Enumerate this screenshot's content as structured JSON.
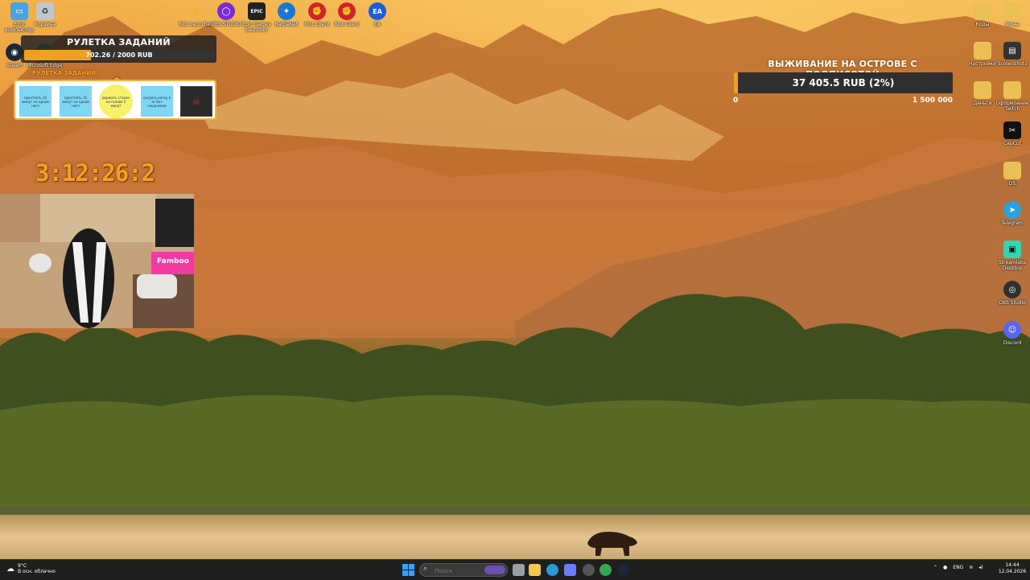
{
  "desktop_left": [
    {
      "label": "Этот компьютер",
      "icon": "monitor-icon",
      "color": "#4aa3df"
    },
    {
      "label": "Корзина",
      "icon": "recycle-bin-icon",
      "color": "#bfc8d0"
    },
    {
      "label": "Steam",
      "icon": "steam-icon",
      "color": "#1b2838"
    },
    {
      "label": "Microsoft Edge",
      "icon": "edge-icon",
      "color": "#2a8a6a"
    }
  ],
  "desktop_top": [
    {
      "label": "Riot Launcher",
      "icon": "riot-launcher-icon",
      "color": "#f2b20f"
    },
    {
      "label": "OBS STUDIO",
      "icon": "obs-circle-icon",
      "color": "#7a2bd6"
    },
    {
      "label": "Epic Games Launcher",
      "icon": "epic-games-icon",
      "color": "#222222",
      "glyph": "EPIC"
    },
    {
      "label": "BattleNet",
      "icon": "battlenet-icon",
      "color": "#1a77d4"
    },
    {
      "label": "Riot Client",
      "icon": "riot-client-icon",
      "color": "#d2232a"
    },
    {
      "label": "Riot Client",
      "icon": "riot-client-2-icon",
      "color": "#d2232a"
    },
    {
      "label": "EA",
      "icon": "ea-icon",
      "color": "#1c5de0",
      "glyph": "EA"
    }
  ],
  "desktop_right": [
    {
      "label": "Коды",
      "icon": "folder-icon",
      "color": "#eac054"
    },
    {
      "label": "Фоны",
      "icon": "folder-icon",
      "color": "#eac054"
    },
    {
      "label": "Настройки",
      "icon": "folder-icon",
      "color": "#eac054"
    },
    {
      "label": "Screenshots",
      "icon": "screenshots-icon",
      "color": "#333333"
    },
    {
      "label": "Деньги",
      "icon": "folder-icon",
      "color": "#eac054"
    },
    {
      "label": "Оформление Twitch",
      "icon": "folder-icon",
      "color": "#eac054"
    },
    {
      "label": "CapCut",
      "icon": "capcut-icon",
      "color": "#111111"
    },
    {
      "label": "DS",
      "icon": "folder-icon",
      "color": "#eac054"
    },
    {
      "label": "Telegram",
      "icon": "telegram-icon",
      "color": "#2aa3dc"
    },
    {
      "label": "Streamlabs Desktop",
      "icon": "streamlabs-icon",
      "color": "#2fd6b0"
    },
    {
      "label": "OBS Studio",
      "icon": "obs-icon",
      "color": "#303030"
    },
    {
      "label": "Discord",
      "icon": "discord-icon",
      "color": "#5865f2"
    }
  ],
  "roulette": {
    "title": "РУЛЕТКА ЗАДАНИЙ",
    "value_text": "702.26 / 2000 RUB",
    "progress": 0.351,
    "subtitle": "РУЛЕТКА ЗАДАНИЙ",
    "cards": [
      "простоять 10 минут на одной ноге",
      "простоять 10 минут на одной ноге",
      "держать стакан на голове 5 минут",
      "сыграть катку в кс без наушников",
      "☠"
    ]
  },
  "timer": "3:12:26:2",
  "goal": {
    "title": "ВЫЖИВАНИЕ НА ОСТРОВЕ С ПОДПИСОТОЙ",
    "value_text": "37 405.5 RUB (2%)",
    "progress": 0.02,
    "min": "0",
    "max": "1 500 000"
  },
  "webcam": {
    "sign": "Famboo"
  },
  "taskbar": {
    "weather_temp": "9°C",
    "weather_desc": "В осн. облачно",
    "search_placeholder": "Поиск",
    "language": "ENG",
    "time": "14:44",
    "date": "12.04.2026",
    "apps": [
      {
        "name": "task-view-icon",
        "color": "#9aa0a6"
      },
      {
        "name": "file-explorer-icon",
        "color": "#f2c94c"
      },
      {
        "name": "edge-icon",
        "color": "#2b9ad8"
      },
      {
        "name": "store-icon",
        "color": "#6b7cff"
      },
      {
        "name": "obs-icon",
        "color": "#555555"
      },
      {
        "name": "chrome-icon",
        "color": "#34a853"
      },
      {
        "name": "steam-icon",
        "color": "#1b2838"
      }
    ]
  }
}
